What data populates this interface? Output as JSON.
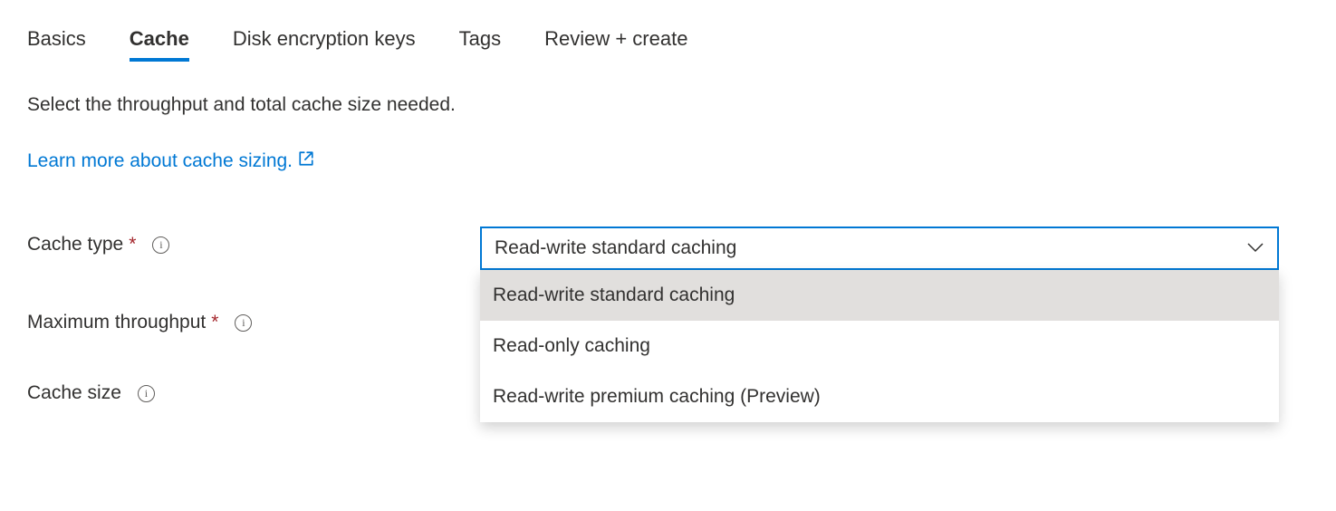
{
  "tabs": {
    "items": [
      {
        "label": "Basics",
        "active": false
      },
      {
        "label": "Cache",
        "active": true
      },
      {
        "label": "Disk encryption keys",
        "active": false
      },
      {
        "label": "Tags",
        "active": false
      },
      {
        "label": "Review + create",
        "active": false
      }
    ]
  },
  "description": "Select the throughput and total cache size needed.",
  "learn_link": "Learn more about cache sizing.",
  "fields": {
    "cache_type": {
      "label": "Cache type",
      "required": true,
      "selected": "Read-write standard caching",
      "options": [
        "Read-write standard caching",
        "Read-only caching",
        "Read-write premium caching (Preview)"
      ]
    },
    "max_throughput": {
      "label": "Maximum throughput",
      "required": true
    },
    "cache_size": {
      "label": "Cache size",
      "required": false
    }
  }
}
